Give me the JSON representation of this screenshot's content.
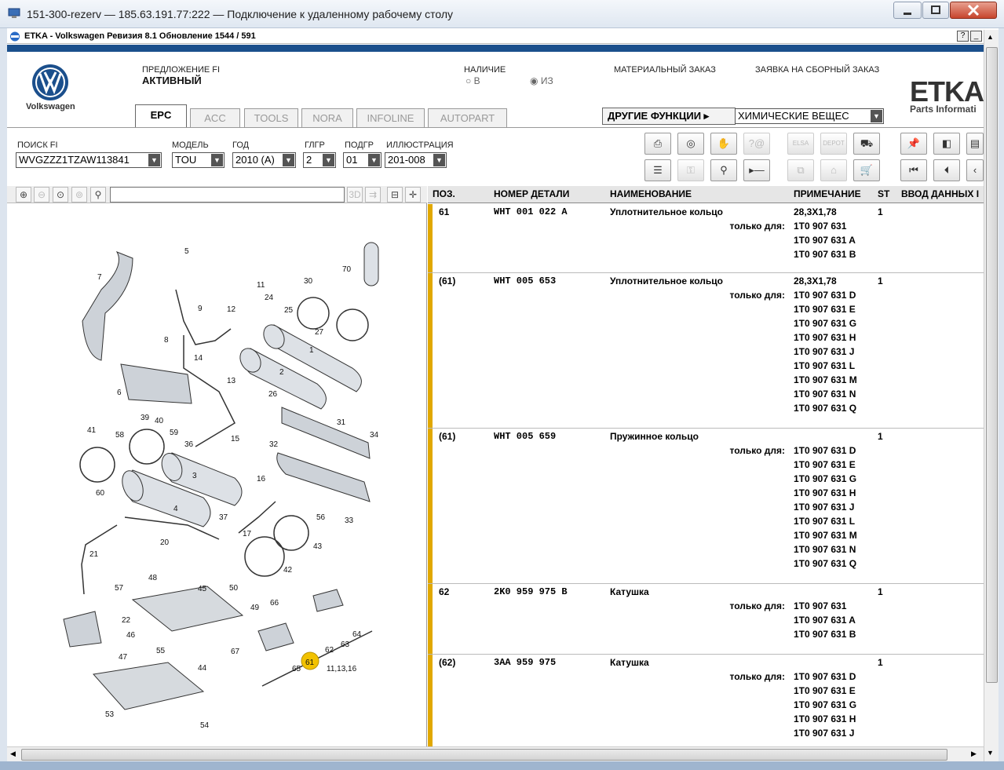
{
  "window": {
    "title": "151-300-rezerv — 185.63.191.77:222 — Подключение к удаленному рабочему столу",
    "app_title": "ETKA - Volkswagen Ревизия 8.1 Обновление 1544 / 591",
    "mini_help": "?",
    "mini_min": "_"
  },
  "header": {
    "brand": "Volkswagen",
    "offer_label": "ПРЕДЛОЖЕНИЕ FI",
    "offer_value": "АКТИВНЫЙ",
    "availability_label": "НАЛИЧИЕ",
    "radio_in": "В",
    "radio_from": "ИЗ",
    "material_order": "МАТЕРИАЛЬНЫЙ ЗАКАЗ",
    "assembly_order": "ЗАЯВКА НА СБОРНЫЙ ЗАКАЗ",
    "other_functions": "ДРУГИЕ ФУНКЦИИ",
    "chemicals": "ХИМИЧЕСКИЕ ВЕЩЕС",
    "etka_logo": "ETKA",
    "etka_sub": "Parts Informati",
    "tabs": [
      "EPC",
      "ACC",
      "TOOLS",
      "NORA",
      "INFOLINE",
      "AUTOPART"
    ]
  },
  "search": {
    "fi_label": "ПОИСК FI",
    "fi_value": "WVGZZZ1TZAW113841",
    "model_label": "МОДЕЛЬ",
    "model_value": "TOU",
    "year_label": "ГОД",
    "year_value": "2010 (A)",
    "mg_label": "ГЛГР",
    "mg_value": "2",
    "sg_label": "ПОДГР",
    "sg_value": "01",
    "illus_label": "ИЛЛЮСТРАЦИЯ",
    "illus_value": "201-008"
  },
  "toolbar": {
    "elsa": "ELSA",
    "depot": "DEPOT"
  },
  "diagram": {
    "labels": [
      "1",
      "2",
      "3",
      "4",
      "5",
      "6",
      "7",
      "8",
      "9",
      "11",
      "12",
      "13",
      "14",
      "15",
      "16",
      "17",
      "20",
      "21",
      "22",
      "24",
      "25",
      "26",
      "27",
      "30",
      "31",
      "32",
      "33",
      "34",
      "36",
      "37",
      "39",
      "40",
      "41",
      "42",
      "43",
      "44",
      "45",
      "46",
      "47",
      "48",
      "49",
      "50",
      "53",
      "54",
      "55",
      "56",
      "57",
      "58",
      "59",
      "60",
      "61",
      "62",
      "63",
      "64",
      "65",
      "66",
      "67",
      "70",
      "11,13,16"
    ]
  },
  "parts": {
    "columns": {
      "pos": "ПОЗ.",
      "part_no": "НОМЕР ДЕТАЛИ",
      "name": "НАИМЕНОВАНИЕ",
      "note": "ПРИМЕЧАНИЕ",
      "st": "ST",
      "input": "ВВОД ДАННЫХ I"
    },
    "only_for": "только для:",
    "rows": [
      {
        "pos": "61",
        "part": "WHT 001 022 A",
        "name": "Уплотнительное кольцо",
        "note": "28,3X1,78",
        "st": "1",
        "fits": [
          "1T0 907 631",
          "1T0 907 631 A",
          "1T0 907 631 B"
        ]
      },
      {
        "pos": "(61)",
        "part": "WHT 005 653",
        "name": "Уплотнительное кольцо",
        "note": "28,3X1,78",
        "st": "1",
        "fits": [
          "1T0 907 631 D",
          "1T0 907 631 E",
          "1T0 907 631 G",
          "1T0 907 631 H",
          "1T0 907 631 J",
          "1T0 907 631 L",
          "1T0 907 631 M",
          "1T0 907 631 N",
          "1T0 907 631 Q"
        ]
      },
      {
        "pos": "(61)",
        "part": "WHT 005 659",
        "name": "Пружинное кольцо",
        "note": "",
        "st": "1",
        "fits": [
          "1T0 907 631 D",
          "1T0 907 631 E",
          "1T0 907 631 G",
          "1T0 907 631 H",
          "1T0 907 631 J",
          "1T0 907 631 L",
          "1T0 907 631 M",
          "1T0 907 631 N",
          "1T0 907 631 Q"
        ]
      },
      {
        "pos": "62",
        "part": "2K0 959 975 B",
        "name": "Катушка",
        "note": "",
        "st": "1",
        "fits": [
          "1T0 907 631",
          "1T0 907 631 A",
          "1T0 907 631 B"
        ]
      },
      {
        "pos": "(62)",
        "part": "3AA 959 975",
        "name": "Катушка",
        "note": "",
        "st": "1",
        "fits": [
          "1T0 907 631 D",
          "1T0 907 631 E",
          "1T0 907 631 G",
          "1T0 907 631 H",
          "1T0 907 631 J"
        ]
      }
    ]
  },
  "colors": {
    "accent_bar": "#1b4f8c",
    "row_marker": "#e1a800",
    "highlight_callout": "#f2c200"
  }
}
